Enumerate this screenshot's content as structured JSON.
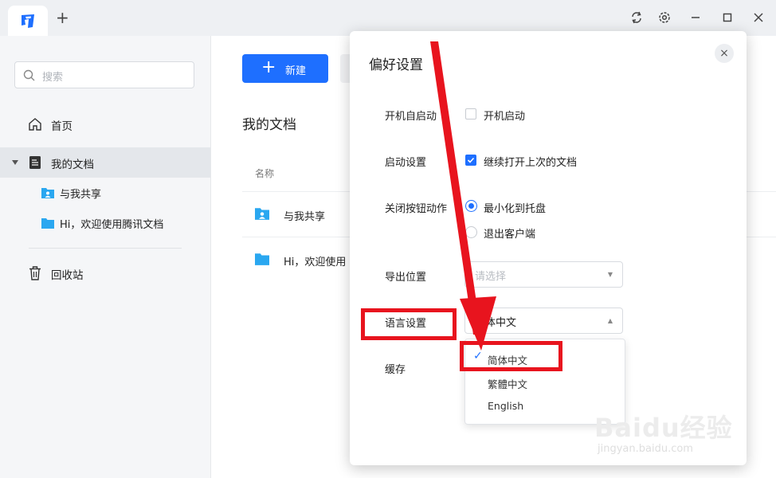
{
  "app": {
    "new_tab": "+"
  },
  "titlebar": {
    "icons": [
      "refresh-icon",
      "settings-icon",
      "minimize-icon",
      "maximize-icon",
      "close-icon"
    ]
  },
  "sidebar": {
    "search_placeholder": "搜索",
    "items": [
      {
        "label": "首页",
        "icon": "home-icon"
      },
      {
        "label": "我的文档",
        "icon": "document-icon"
      },
      {
        "label": "与我共享",
        "icon": "shared-folder-icon"
      },
      {
        "label": "Hi，欢迎使用腾讯文档",
        "icon": "folder-icon"
      },
      {
        "label": "回收站",
        "icon": "trash-icon"
      }
    ]
  },
  "main": {
    "new_button": "新建",
    "title": "我的文档",
    "column_name": "名称",
    "rows": [
      {
        "name": "与我共享"
      },
      {
        "name": "Hi，欢迎使用"
      }
    ]
  },
  "dialog": {
    "title": "偏好设置",
    "close": "×",
    "startup_label": "开机自启动",
    "startup_option": "开机启动",
    "startup_checked": false,
    "launch_label": "启动设置",
    "launch_option": "继续打开上次的文档",
    "launch_checked": true,
    "close_label": "关闭按钮动作",
    "close_options": [
      "最小化到托盘",
      "退出客户端"
    ],
    "close_selected": "最小化到托盘",
    "export_label": "导出位置",
    "export_placeholder": "请选择",
    "language_label": "语言设置",
    "language_value": "简体中文",
    "cache_label": "缓存",
    "language_options": [
      "简体中文",
      "繁體中文",
      "English"
    ],
    "language_selected": "简体中文"
  },
  "annotation": {
    "color": "#e8141e"
  },
  "watermark": {
    "text": "Baidu经验",
    "sub": "jingyan.baidu.com"
  },
  "colors": {
    "accent": "#1e6fff",
    "sidebar_bg": "#f5f6f8",
    "titlebar_bg": "#eef0f3"
  }
}
